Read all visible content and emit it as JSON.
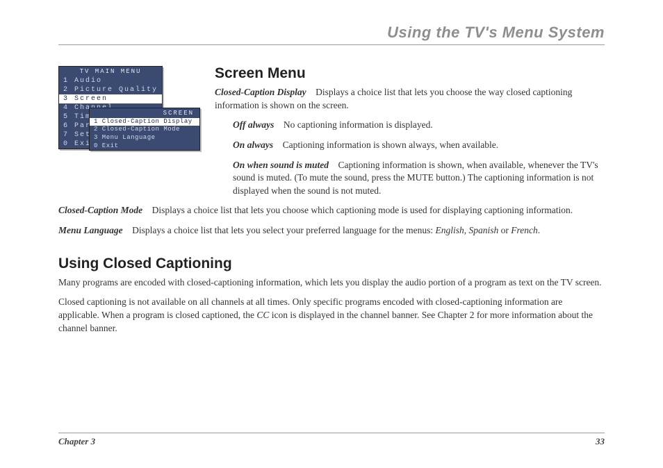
{
  "header": {
    "title": "Using the TV's Menu System"
  },
  "menu": {
    "main_title": "TV MAIN MENU",
    "items": [
      {
        "n": "1",
        "label": "Audio"
      },
      {
        "n": "2",
        "label": "Picture Quality"
      },
      {
        "n": "3",
        "label": "Screen",
        "selected": true
      },
      {
        "n": "4",
        "label": "Channel"
      },
      {
        "n": "5",
        "label": "Time"
      },
      {
        "n": "6",
        "label": "Pare"
      },
      {
        "n": "7",
        "label": "Setu"
      },
      {
        "n": "0",
        "label": "Exit"
      }
    ],
    "sub_title": "SCREEN",
    "sub_items": [
      {
        "n": "1",
        "label": "Closed-Caption Display",
        "selected": true
      },
      {
        "n": "2",
        "label": "Closed-Caption Mode"
      },
      {
        "n": "3",
        "label": "Menu Language"
      },
      {
        "n": "0",
        "label": "Exit"
      }
    ]
  },
  "section1": {
    "heading": "Screen Menu",
    "cc_display_term": "Closed-Caption Display",
    "cc_display_text": "Displays a choice list that lets you choose the way closed captioning information is shown on the screen.",
    "off_term": "Off always",
    "off_text": "No captioning information is displayed.",
    "on_term": "On always",
    "on_text": "Captioning information is shown always, when available.",
    "muted_term": "On when sound is muted",
    "muted_text": "Captioning information is shown, when available, whenever the TV's sound is muted. (To mute the sound, press the MUTE button.) The captioning information is not displayed when the sound is not muted.",
    "cc_mode_term": "Closed-Caption Mode",
    "cc_mode_text": "Displays a choice list that lets you choose which captioning mode is used for displaying captioning information.",
    "lang_term": "Menu Language",
    "lang_text_a": "Displays a choice list that lets you select your preferred language for the menus: ",
    "lang_en": "English",
    "lang_sep1": ", ",
    "lang_es": "Spanish",
    "lang_sep2": " or ",
    "lang_fr": "French",
    "lang_end": "."
  },
  "section2": {
    "heading": "Using Closed Captioning",
    "p1": "Many programs are encoded with closed-captioning information, which lets you display the audio portion of a program as text on the TV screen.",
    "p2a": "Closed captioning is not available on all channels at all times. Only specific programs encoded with closed-captioning information are applicable. When a program is closed captioned, the ",
    "cc_icon": "CC",
    "p2b": " icon is displayed in the channel banner. See Chapter 2 for more information about the channel banner."
  },
  "footer": {
    "chapter": "Chapter 3",
    "page": "33"
  }
}
